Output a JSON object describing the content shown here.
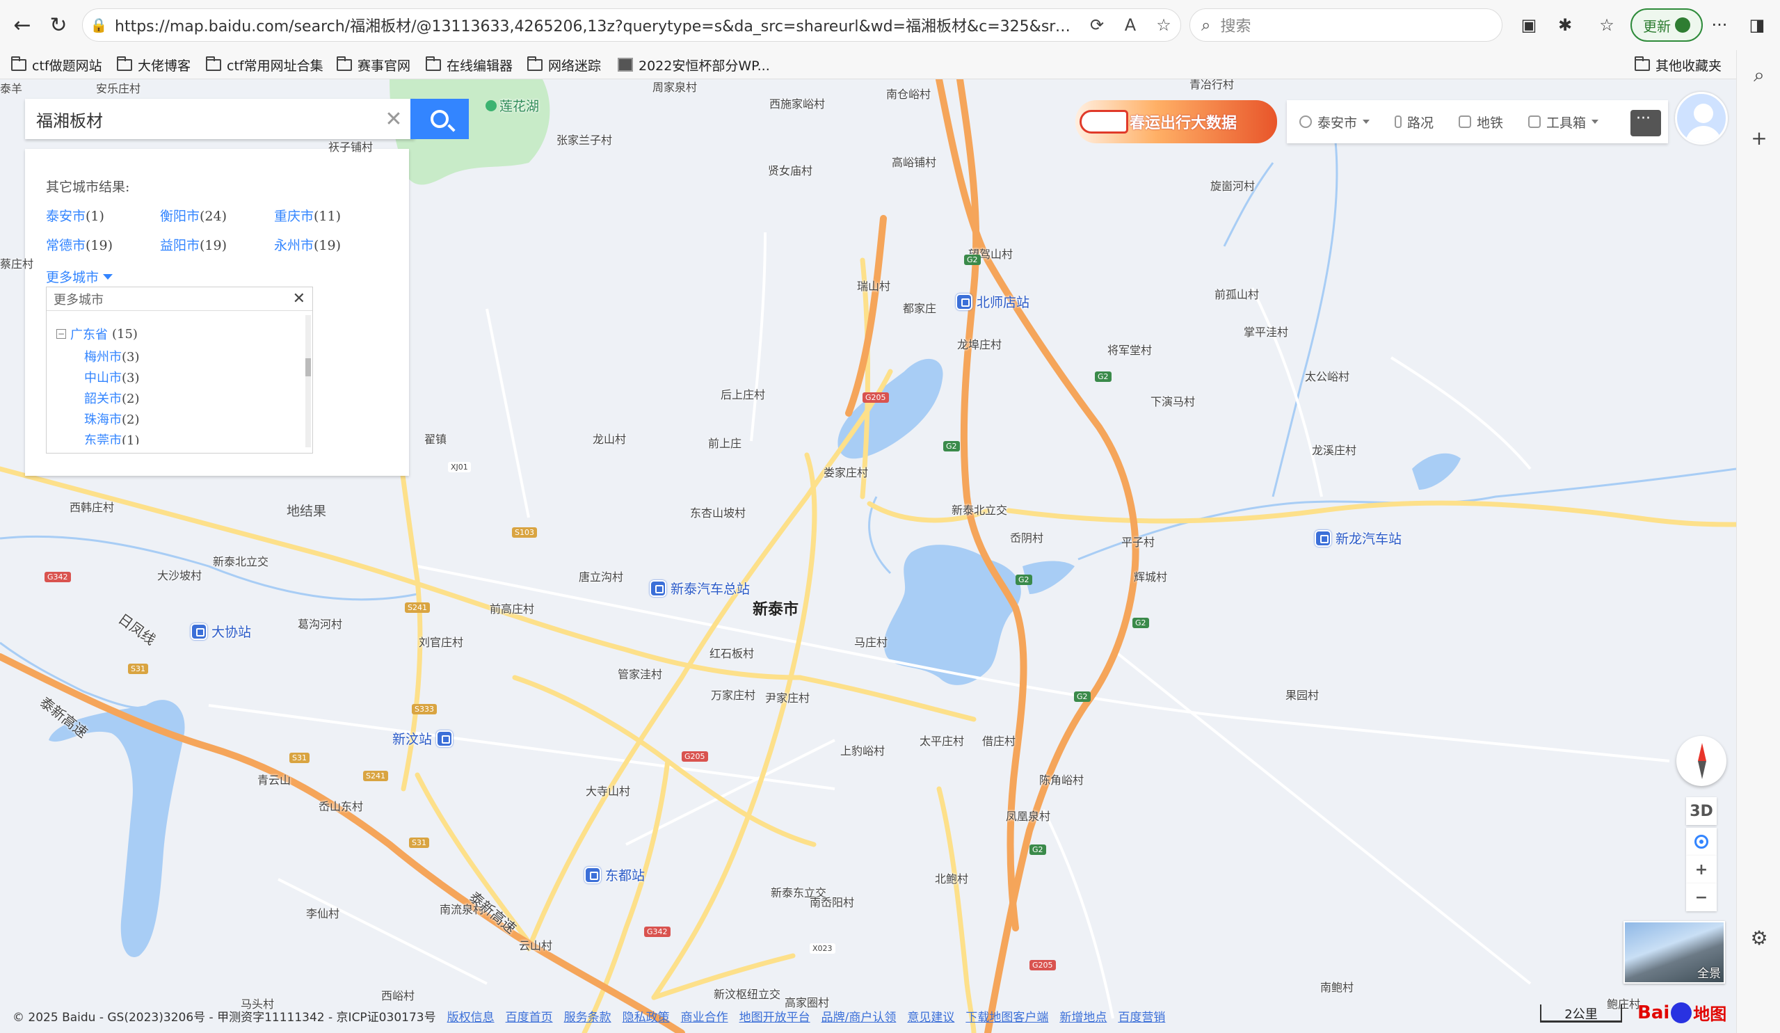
{
  "browser": {
    "url": "https://map.baidu.com/search/福湘板材/@13113633,4265206,13z?querytype=s&da_src=shareurl&wd=福湘板材&c=325&src=0&pn=0&sug=0&l...",
    "search_placeholder": "搜索",
    "update_label": "更新",
    "icons": [
      "back-icon",
      "refresh-icon",
      "lock-icon",
      "read-aloud-icon",
      "favorite-icon",
      "extensions-icon",
      "collections-icon",
      "more-icon"
    ]
  },
  "bookmarks": {
    "items": [
      "ctf做题网站",
      "大佬博客",
      "ctf常用网址合集",
      "赛事官网",
      "在线编辑器",
      "网络迷踪",
      "2022安恒杯部分WP..."
    ],
    "other": "其他收藏夹"
  },
  "map": {
    "search": {
      "query": "福湘板材"
    },
    "results": {
      "title": "其它城市结果:",
      "cities": [
        {
          "name": "泰安市",
          "count": "(1)"
        },
        {
          "name": "衡阳市",
          "count": "(24)"
        },
        {
          "name": "重庆市",
          "count": "(11)"
        },
        {
          "name": "常德市",
          "count": "(19)"
        },
        {
          "name": "益阳市",
          "count": "(19)"
        },
        {
          "name": "永州市",
          "count": "(19)"
        }
      ],
      "more_label": "更多城市",
      "more_box": {
        "header": "更多城市",
        "province": {
          "name": "广东省",
          "count": "(15)"
        },
        "subs": [
          {
            "name": "梅州市",
            "count": "(3)"
          },
          {
            "name": "中山市",
            "count": "(3)"
          },
          {
            "name": "韶关市",
            "count": "(2)"
          },
          {
            "name": "珠海市",
            "count": "(2)"
          },
          {
            "name": "东莞市",
            "count": "(1)"
          }
        ]
      },
      "local_results": "地结果"
    },
    "banner": "春运出行大数据",
    "toolbar": {
      "city": "泰安市",
      "traffic": "路况",
      "subway": "地铁",
      "toolbox": "工具箱"
    },
    "labels": {
      "city_main": "新泰市",
      "villages": [
        "安乐庄村",
        "周家泉村",
        "西施家峪村",
        "南仓峪村",
        "青冶行村",
        "祆子铺村",
        "张家兰子村",
        "贤女庙村",
        "高峪铺村",
        "旋崮河村",
        "望驾山村",
        "瑞山村",
        "都家庄",
        "前孤山村",
        "掌平洼村",
        "龙埠庄村",
        "将军堂村",
        "太公峪村",
        "后上庄村",
        "下演马村",
        "翟镇",
        "龙山村",
        "前上庄",
        "龙溪庄村",
        "娄家庄村",
        "西韩庄村",
        "东杏山坡村",
        "新泰北立交",
        "岙阴村",
        "平子村",
        "新泰北立交",
        "唐立沟村",
        "辉城村",
        "大沙坡村",
        "前高庄村",
        "葛沟河村",
        "刘官庄村",
        "红石板村",
        "马庄村",
        "管家洼村",
        "万家庄村",
        "尹家庄村",
        "果园村",
        "上豹峪村",
        "太平庄村",
        "借庄村",
        "青云山",
        "陈角峪村",
        "岙山东村",
        "大寺山村",
        "凤凰泉村",
        "新泰东立交",
        "北鲍村",
        "南岙阳村",
        "李仙村",
        "南流泉村",
        "云山村",
        "新汶枢纽立交",
        "南鲍村",
        "西峪村",
        "马头村",
        "高家圈村",
        "鲍庄村",
        "蔡庄村",
        "泰羊"
      ],
      "lake": "莲花湖",
      "stations": [
        "北师店站",
        "新泰汽车总站",
        "新龙汽车站",
        "大协站",
        "新汶站",
        "东都站"
      ],
      "highways": [
        "日凤线",
        "泰新高速",
        "泰新高速"
      ],
      "road_codes": [
        "G2",
        "G2",
        "G205",
        "G2",
        "G2",
        "G2",
        "G2",
        "G2",
        "G205",
        "G342",
        "S103",
        "S241",
        "S31",
        "S333",
        "S31",
        "S241",
        "S31",
        "G205",
        "G342",
        "XJ01",
        "X023"
      ]
    },
    "controls": {
      "view3d": "3D",
      "zoom_in": "+",
      "zoom_out": "−",
      "pano": "全景",
      "scale": "2公里"
    },
    "footer": {
      "copyright": "© 2025 Baidu - GS(2023)3206号 - 甲测资字11111342 - 京ICP证030173号",
      "links": [
        "版权信息",
        "百度首页",
        "服务条款",
        "隐私政策",
        "商业合作",
        "地图开放平台",
        "品牌/商户认领",
        "意见建议",
        "下载地图客户端",
        "新增地点",
        "百度营销"
      ]
    },
    "logo": {
      "left": "Bai",
      "right": "地图"
    }
  }
}
